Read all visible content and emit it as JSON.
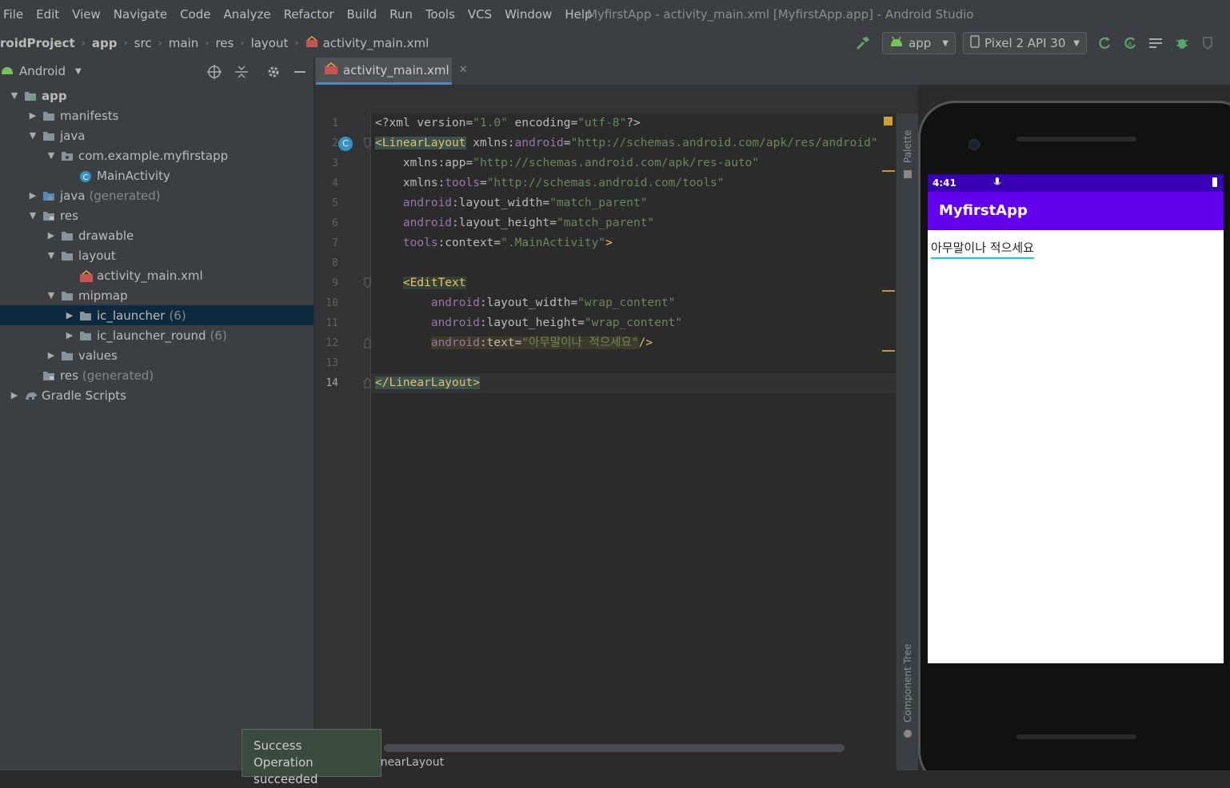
{
  "window_title": "MyfirstApp - activity_main.xml [MyfirstApp.app] - Android Studio",
  "menu": [
    "File",
    "Edit",
    "View",
    "Navigate",
    "Code",
    "Analyze",
    "Refactor",
    "Build",
    "Run",
    "Tools",
    "VCS",
    "Window",
    "Help"
  ],
  "breadcrumbs": [
    "roidProject",
    "app",
    "src",
    "main",
    "res",
    "layout",
    "activity_main.xml"
  ],
  "toolbar": {
    "run_config": "app",
    "device": "Pixel 2 API 30"
  },
  "project_panel": {
    "view_mode": "Android",
    "tree": [
      {
        "label": "app",
        "indent": 0,
        "arrow": "expanded",
        "icon": "module-icon",
        "bold": true
      },
      {
        "label": "manifests",
        "indent": 1,
        "arrow": "collapsed",
        "icon": "folder-icon"
      },
      {
        "label": "java",
        "indent": 1,
        "arrow": "expanded",
        "icon": "folder-icon"
      },
      {
        "label": "com.example.myfirstapp",
        "indent": 2,
        "arrow": "expanded",
        "icon": "package-icon"
      },
      {
        "label": "MainActivity",
        "indent": 3,
        "arrow": "",
        "icon": "class-icon"
      },
      {
        "label": "java",
        "dim": "(generated)",
        "indent": 1,
        "arrow": "collapsed",
        "icon": "generated-folder-icon"
      },
      {
        "label": "res",
        "indent": 1,
        "arrow": "expanded",
        "icon": "res-folder-icon"
      },
      {
        "label": "drawable",
        "indent": 2,
        "arrow": "collapsed",
        "icon": "folder-icon"
      },
      {
        "label": "layout",
        "indent": 2,
        "arrow": "expanded",
        "icon": "folder-icon"
      },
      {
        "label": "activity_main.xml",
        "indent": 3,
        "arrow": "",
        "icon": "xml-layout-icon"
      },
      {
        "label": "mipmap",
        "indent": 2,
        "arrow": "expanded",
        "icon": "folder-icon"
      },
      {
        "label": "ic_launcher",
        "dim": "(6)",
        "indent": 3,
        "arrow": "collapsed",
        "icon": "folder-icon",
        "selected": true
      },
      {
        "label": "ic_launcher_round",
        "dim": "(6)",
        "indent": 3,
        "arrow": "collapsed",
        "icon": "folder-icon"
      },
      {
        "label": "values",
        "indent": 2,
        "arrow": "collapsed",
        "icon": "folder-icon"
      },
      {
        "label": "res",
        "dim": "(generated)",
        "indent": 1,
        "arrow": "",
        "icon": "res-folder-icon"
      },
      {
        "label": "Gradle Scripts",
        "indent": 0,
        "arrow": "collapsed",
        "icon": "gradle-icon"
      }
    ]
  },
  "editor": {
    "tab_label": "activity_main.xml",
    "line_numbers": [
      "1",
      "2",
      "3",
      "4",
      "5",
      "6",
      "7",
      "8",
      "9",
      "10",
      "11",
      "12",
      "13",
      "14"
    ],
    "current_line": "14",
    "lines": [
      [
        {
          "t": "<?xml version=",
          "c": "attr"
        },
        {
          "t": "\"1.0\"",
          "c": "str"
        },
        {
          "t": " encoding=",
          "c": "attr"
        },
        {
          "t": "\"utf-8\"",
          "c": "str"
        },
        {
          "t": "?>",
          "c": "attr"
        }
      ],
      [
        {
          "t": "<LinearLayout",
          "c": "tag hl"
        },
        {
          "t": " xmlns:",
          "c": "attr"
        },
        {
          "t": "android",
          "c": "ns"
        },
        {
          "t": "=",
          "c": "attr"
        },
        {
          "t": "\"http://schemas.android.com/apk/res/android\"",
          "c": "str"
        }
      ],
      [
        {
          "t": "    xmlns:app=",
          "c": "attr"
        },
        {
          "t": "\"http://schemas.android.com/apk/res-auto\"",
          "c": "str"
        }
      ],
      [
        {
          "t": "    xmlns:",
          "c": "attr"
        },
        {
          "t": "tools",
          "c": "ns"
        },
        {
          "t": "=",
          "c": "attr"
        },
        {
          "t": "\"http://schemas.android.com/tools\"",
          "c": "str"
        }
      ],
      [
        {
          "t": "    ",
          "c": "attr"
        },
        {
          "t": "android",
          "c": "ns"
        },
        {
          "t": ":layout_width=",
          "c": "attr"
        },
        {
          "t": "\"match_parent\"",
          "c": "str"
        }
      ],
      [
        {
          "t": "    ",
          "c": "attr"
        },
        {
          "t": "android",
          "c": "ns"
        },
        {
          "t": ":layout_height=",
          "c": "attr"
        },
        {
          "t": "\"match_parent\"",
          "c": "str"
        }
      ],
      [
        {
          "t": "    ",
          "c": "attr"
        },
        {
          "t": "tools",
          "c": "ns"
        },
        {
          "t": ":context=",
          "c": "attr"
        },
        {
          "t": "\".MainActivity\"",
          "c": "str"
        },
        {
          "t": ">",
          "c": "tag"
        }
      ],
      [],
      [
        {
          "t": "    ",
          "c": "attr"
        },
        {
          "t": "<EditText",
          "c": "tag hl2"
        }
      ],
      [
        {
          "t": "        ",
          "c": "attr"
        },
        {
          "t": "android",
          "c": "ns"
        },
        {
          "t": ":layout_width=",
          "c": "attr"
        },
        {
          "t": "\"wrap_content\"",
          "c": "str"
        }
      ],
      [
        {
          "t": "        ",
          "c": "attr"
        },
        {
          "t": "android",
          "c": "ns"
        },
        {
          "t": ":layout_height=",
          "c": "attr"
        },
        {
          "t": "\"wrap_content\"",
          "c": "str"
        }
      ],
      [
        {
          "t": "        ",
          "c": "attr"
        },
        {
          "t": "android",
          "c": "ns hlattr"
        },
        {
          "t": ":text=",
          "c": "attr hlattr"
        },
        {
          "t": "\"아무말이나 적으세요\"",
          "c": "str hlattr"
        },
        {
          "t": "/>",
          "c": "tag"
        }
      ],
      [],
      [
        {
          "t": "</LinearLayout>",
          "c": "tag hl"
        }
      ]
    ],
    "status_text": "LinearLayout"
  },
  "side_tools": {
    "palette": "Palette",
    "component_tree": "Component Tree"
  },
  "preview": {
    "time": "4:41",
    "app_title": "MyfirstApp",
    "edit_text": "아무말이나 적으세요"
  },
  "toast": {
    "title": "Success",
    "message": "Operation succeeded"
  },
  "colors": {
    "accent": "#4a88c7",
    "app_bar": "#6200ee",
    "status_bar": "#3700b3",
    "edit_underline": "#03dac5"
  }
}
